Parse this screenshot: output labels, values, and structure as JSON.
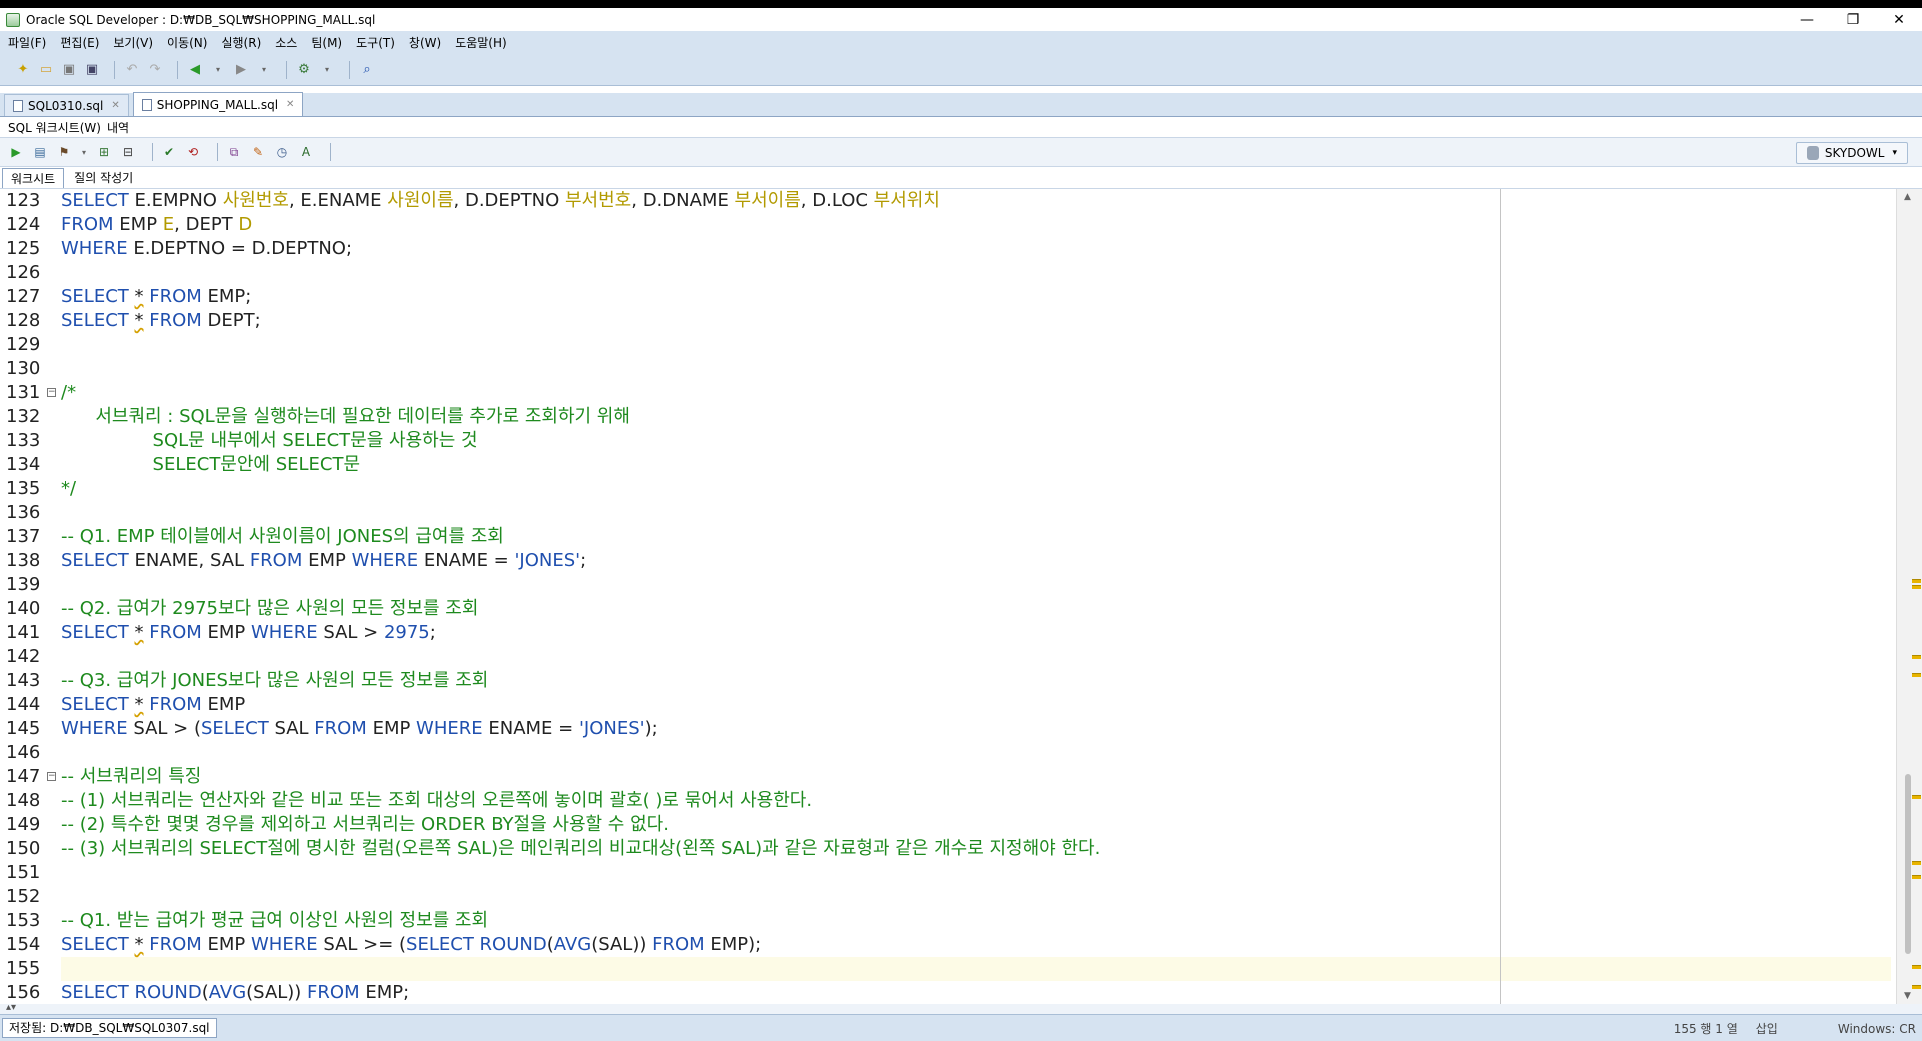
{
  "window": {
    "title": "Oracle SQL Developer : D:₩DB_SQL₩SHOPPING_MALL.sql",
    "controls": [
      "—",
      "❐",
      "✕"
    ]
  },
  "menu": [
    "파일(F)",
    "편집(E)",
    "보기(V)",
    "이동(N)",
    "실행(R)",
    "소스",
    "팀(M)",
    "도구(T)",
    "창(W)",
    "도움말(H)"
  ],
  "editor_tabs": [
    {
      "label": "SQL0310.sql",
      "active": false
    },
    {
      "label": "SHOPPING_MALL.sql",
      "active": true
    }
  ],
  "subtabs": [
    "SQL 워크시트(W)",
    "내역"
  ],
  "connection": "SKYDOWL",
  "worksheet_tabs": [
    "워크시트",
    "질의 작성기"
  ],
  "line_numbers": [
    "123",
    "124",
    "125",
    "126",
    "127",
    "128",
    "129",
    "130",
    "131",
    "132",
    "133",
    "134",
    "135",
    "136",
    "137",
    "138",
    "139",
    "140",
    "141",
    "142",
    "143",
    "144",
    "145",
    "146",
    "147",
    "148",
    "149",
    "150",
    "151",
    "152",
    "153",
    "154",
    "155",
    "156"
  ],
  "code_lines": [
    {
      "n": "123",
      "text": "SELECT E.EMPNO 사원번호, E.ENAME 사원이름, D.DEPTNO 부서번호, D.DNAME 부서이름, D.LOC 부서위치"
    },
    {
      "n": "124",
      "text": "FROM EMP E, DEPT D"
    },
    {
      "n": "125",
      "text": "WHERE E.DEPTNO = D.DEPTNO;"
    },
    {
      "n": "126",
      "text": ""
    },
    {
      "n": "127",
      "text": "SELECT * FROM EMP;"
    },
    {
      "n": "128",
      "text": "SELECT * FROM DEPT;"
    },
    {
      "n": "129",
      "text": ""
    },
    {
      "n": "130",
      "text": ""
    },
    {
      "n": "131",
      "text": "/*"
    },
    {
      "n": "132",
      "text": "      서브쿼리 : SQL문을 실행하는데 필요한 데이터를 추가로 조회하기 위해"
    },
    {
      "n": "133",
      "text": "                SQL문 내부에서 SELECT문을 사용하는 것"
    },
    {
      "n": "134",
      "text": "                SELECT문안에 SELECT문"
    },
    {
      "n": "135",
      "text": "*/"
    },
    {
      "n": "136",
      "text": ""
    },
    {
      "n": "137",
      "text": "-- Q1. EMP 테이블에서 사원이름이 JONES의 급여를 조회"
    },
    {
      "n": "138",
      "text": "SELECT ENAME, SAL FROM EMP WHERE ENAME = 'JONES';"
    },
    {
      "n": "139",
      "text": ""
    },
    {
      "n": "140",
      "text": "-- Q2. 급여가 2975보다 많은 사원의 모든 정보를 조회"
    },
    {
      "n": "141",
      "text": "SELECT * FROM EMP WHERE SAL > 2975;"
    },
    {
      "n": "142",
      "text": ""
    },
    {
      "n": "143",
      "text": "-- Q3. 급여가 JONES보다 많은 사원의 모든 정보를 조회"
    },
    {
      "n": "144",
      "text": "SELECT * FROM EMP"
    },
    {
      "n": "145",
      "text": "WHERE SAL > (SELECT SAL FROM EMP WHERE ENAME = 'JONES');"
    },
    {
      "n": "146",
      "text": ""
    },
    {
      "n": "147",
      "text": "-- 서브쿼리의 특징"
    },
    {
      "n": "148",
      "text": "-- (1) 서브쿼리는 연산자와 같은 비교 또는 조회 대상의 오른쪽에 놓이며 괄호( )로 묶어서 사용한다."
    },
    {
      "n": "149",
      "text": "-- (2) 특수한 몇몇 경우를 제외하고 서브쿼리는 ORDER BY절을 사용할 수 없다."
    },
    {
      "n": "150",
      "text": "-- (3) 서브쿼리의 SELECT절에 명시한 컬럼(오른쪽 SAL)은 메인쿼리의 비교대상(왼쪽 SAL)과 같은 자료형과 같은 개수로 지정해야 한다."
    },
    {
      "n": "151",
      "text": ""
    },
    {
      "n": "152",
      "text": ""
    },
    {
      "n": "153",
      "text": "-- Q1. 받는 급여가 평균 급여 이상인 사원의 정보를 조회"
    },
    {
      "n": "154",
      "text": "SELECT * FROM EMP WHERE SAL >= (SELECT ROUND(AVG(SAL)) FROM EMP);"
    },
    {
      "n": "155",
      "text": ""
    },
    {
      "n": "156",
      "text": "SELECT ROUND(AVG(SAL)) FROM EMP;"
    }
  ],
  "status": {
    "saved": "저장됨: D:₩DB_SQL₩SQL0307.sql",
    "position": "155 행 1 열",
    "mode": "삽입",
    "line_ending": "Windows: CR"
  },
  "colors": {
    "keyword": "#1f4fae",
    "alias": "#b29a00",
    "comment": "#1e8a1e",
    "chrome": "#d6e3f1",
    "current_line": "#fdfbe6"
  }
}
